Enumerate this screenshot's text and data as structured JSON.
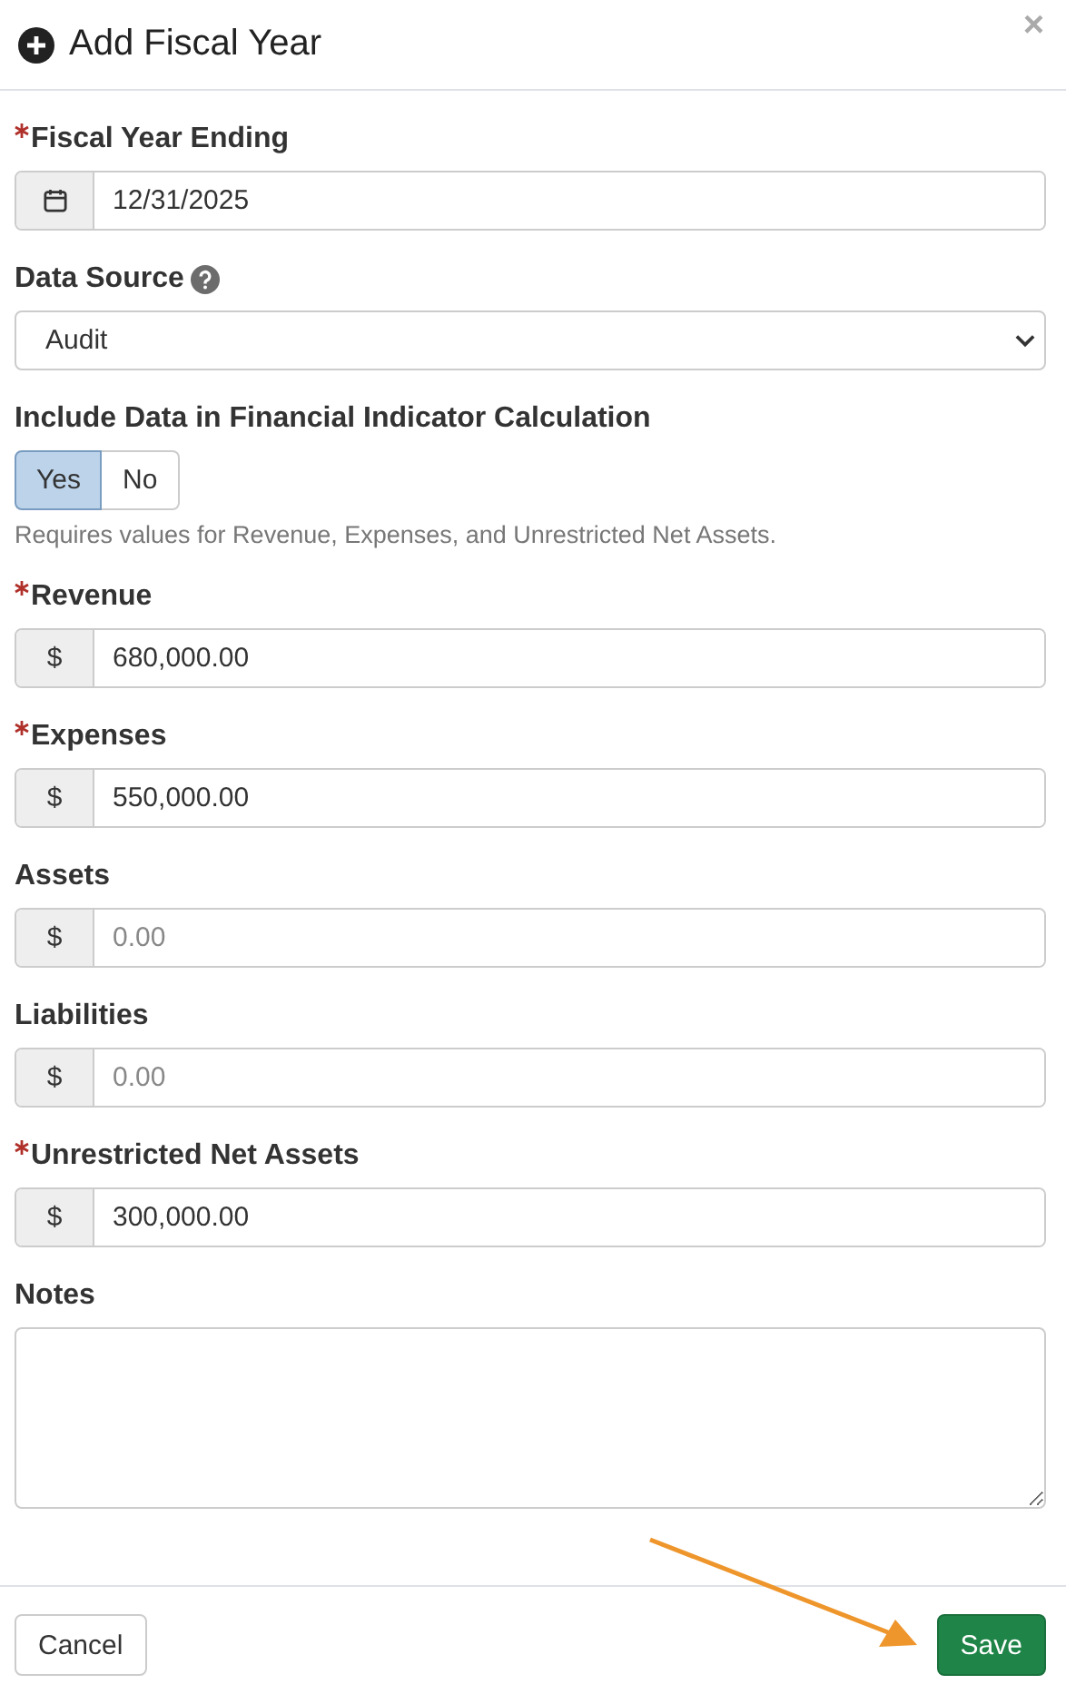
{
  "dialog": {
    "title": "Add Fiscal Year",
    "close": "×"
  },
  "fields": [
    {
      "kind": "date",
      "label": "Fiscal Year Ending",
      "required": true,
      "value": "12/31/2025"
    },
    {
      "kind": "select",
      "label": "Data Source",
      "required": false,
      "help": true,
      "value": "Audit"
    },
    {
      "kind": "toggle",
      "label": "Include Data in Financial Indicator Calculation",
      "required": false,
      "options": [
        {
          "label": "Yes",
          "selected": true
        },
        {
          "label": "No",
          "selected": false
        }
      ],
      "hint": "Requires values for Revenue, Expenses, and Unrestricted Net Assets."
    },
    {
      "kind": "money",
      "label": "Revenue",
      "required": true,
      "prefix": "$",
      "value": "680,000.00"
    },
    {
      "kind": "money",
      "label": "Expenses",
      "required": true,
      "prefix": "$",
      "value": "550,000.00"
    },
    {
      "kind": "money",
      "label": "Assets",
      "required": false,
      "prefix": "$",
      "placeholder": "0.00"
    },
    {
      "kind": "money",
      "label": "Liabilities",
      "required": false,
      "prefix": "$",
      "placeholder": "0.00"
    },
    {
      "kind": "money",
      "label": "Unrestricted Net Assets",
      "required": true,
      "prefix": "$",
      "value": "300,000.00"
    },
    {
      "kind": "textarea",
      "label": "Notes",
      "required": false
    }
  ],
  "buttons": [
    {
      "label": "Cancel",
      "kind": "secondary"
    },
    {
      "label": "Save",
      "kind": "primary"
    }
  ],
  "annotation": {
    "kind": "arrow"
  }
}
